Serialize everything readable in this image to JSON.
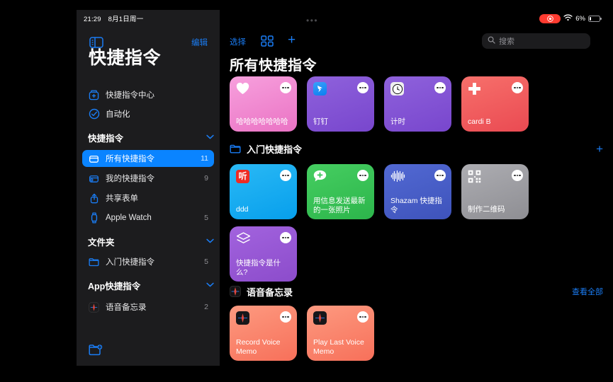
{
  "colors": {
    "accent": "#0a84ff",
    "link": "#1a7df5",
    "sidebar_bg": "#1c1c1e",
    "selected_row": "#0a84ff",
    "recording_red": "#ff3b30"
  },
  "sidebar": {
    "status_time": "21:29",
    "status_date": "8月1日周一",
    "sidebar_toggle_icon": "sidebar-icon",
    "edit_label": "编辑",
    "title": "快捷指令",
    "top_items": [
      {
        "icon": "shortcuts-gallery-icon",
        "label": "快捷指令中心"
      },
      {
        "icon": "automation-icon",
        "label": "自动化"
      }
    ],
    "sections": [
      {
        "header": "快捷指令",
        "collapsed": false,
        "items": [
          {
            "icon": "all-shortcuts-icon",
            "label": "所有快捷指令",
            "count": "11",
            "selected": true
          },
          {
            "icon": "my-shortcuts-icon",
            "label": "我的快捷指令",
            "count": "9",
            "selected": false
          },
          {
            "icon": "share-sheet-icon",
            "label": "共享表单",
            "count": "",
            "selected": false
          },
          {
            "icon": "apple-watch-icon",
            "label": "Apple Watch",
            "count": "5",
            "selected": false
          }
        ]
      },
      {
        "header": "文件夹",
        "collapsed": false,
        "items": [
          {
            "icon": "folder-icon",
            "label": "入门快捷指令",
            "count": "5",
            "selected": false
          }
        ]
      },
      {
        "header": "App快捷指令",
        "collapsed": false,
        "items": [
          {
            "icon": "voice-memos-icon",
            "label": "语音备忘录",
            "count": "2",
            "selected": false
          }
        ]
      }
    ],
    "bottom_icon": "new-folder-icon"
  },
  "main": {
    "status": {
      "multitask_dots": "•••",
      "recording_indicator": "recording-indicator",
      "wifi_icon": "wifi-icon",
      "battery_percent": "6%",
      "battery_icon": "battery-icon"
    },
    "toolbar": {
      "select_label": "选择",
      "grid_icon": "grid-view-icon",
      "add_icon": "plus-icon",
      "add_label": "+"
    },
    "search": {
      "icon": "search-icon",
      "placeholder": "搜索",
      "value": ""
    },
    "page_title": "所有快捷指令",
    "sections": [
      {
        "name": "ungrouped",
        "header": "",
        "icon": "",
        "action": "",
        "cards": [
          {
            "title": "哈哈哈哈哈哈哈",
            "icon": "heart-icon",
            "bg_from": "#f48fd6",
            "bg_to": "#e86cc0",
            "icon_kind": "glyph",
            "glyph": "♥"
          },
          {
            "title": "钉钉",
            "icon": "dingtalk-app-icon",
            "bg_from": "#8a5cd8",
            "bg_to": "#7a46cf",
            "icon_kind": "app",
            "app_bg": "#1a8cf5",
            "glyph": "➤"
          },
          {
            "title": "计时",
            "icon": "clock-app-icon",
            "bg_from": "#8a5cd8",
            "bg_to": "#7a46cf",
            "icon_kind": "app",
            "app_bg": "#f2f2f2",
            "glyph": "🕐"
          },
          {
            "title": "cardi B",
            "icon": "plus-cross-icon",
            "bg_from": "#f4605c",
            "bg_to": "#ec4b52",
            "icon_kind": "glyph",
            "glyph": "✚"
          }
        ]
      },
      {
        "name": "starter-shortcuts",
        "header": "入门快捷指令",
        "icon": "folder-icon",
        "action": "+",
        "action_kind": "plus",
        "cards": [
          {
            "title": "ddd",
            "icon": "ximalaya-app-icon",
            "bg_from": "#20b4f3",
            "bg_to": "#0aa6ef",
            "icon_kind": "app",
            "app_bg": "#ef2b23",
            "glyph": "听"
          },
          {
            "title": "用信息发送最新的一张照片",
            "icon": "messages-add-icon",
            "bg_from": "#3cc65a",
            "bg_to": "#2eb84e",
            "icon_kind": "glyph",
            "glyph": "💬"
          },
          {
            "title": "Shazam 快捷指令",
            "icon": "waveform-icon",
            "bg_from": "#4a62c8",
            "bg_to": "#3c53bd",
            "icon_kind": "glyph",
            "glyph": "〰"
          },
          {
            "title": "制作二维码",
            "icon": "qrcode-icon",
            "bg_from": "#a5a5aa",
            "bg_to": "#909095",
            "icon_kind": "glyph",
            "glyph": "▩"
          }
        ]
      },
      {
        "name": "starter-shortcuts-row2",
        "header": "",
        "icon": "",
        "action": "",
        "cards": [
          {
            "title": "快捷指令是什么?",
            "icon": "layers-icon",
            "bg_from": "#9a5ad6",
            "bg_to": "#8a49cc",
            "icon_kind": "glyph",
            "glyph": "◆"
          }
        ]
      },
      {
        "name": "voice-memos",
        "header": "语音备忘录",
        "icon": "voice-memos-icon",
        "action": "查看全部",
        "action_kind": "link",
        "cards": [
          {
            "title": "Record Voice Memo",
            "icon": "voice-memos-app-icon",
            "bg_from": "#fb8c71",
            "bg_to": "#f97559",
            "icon_kind": "app",
            "app_bg": "#1c1c1e",
            "glyph": ""
          },
          {
            "title": "Play Last Voice Memo",
            "icon": "voice-memos-app-icon",
            "bg_from": "#fb8c71",
            "bg_to": "#f97559",
            "icon_kind": "app",
            "app_bg": "#1c1c1e",
            "glyph": ""
          }
        ]
      }
    ]
  }
}
